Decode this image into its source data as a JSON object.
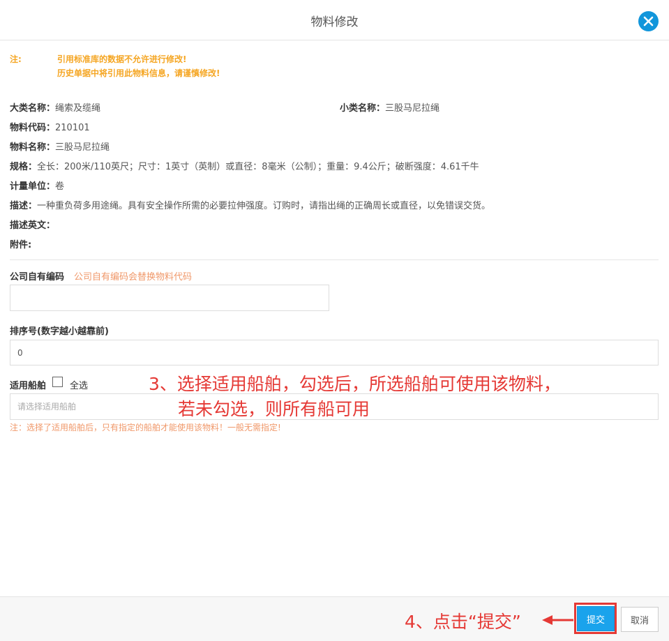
{
  "dialog": {
    "title": "物料修改"
  },
  "note": {
    "label": "注:",
    "lines": [
      "引用标准库的数据不允许进行修改!",
      "历史单据中将引用此物料信息，请谨慎修改!"
    ]
  },
  "info": {
    "category": {
      "label": "大类名称：",
      "value": "绳索及缆绳"
    },
    "subcategory": {
      "label": "小类名称：",
      "value": "三股马尼拉绳"
    },
    "code": {
      "label": "物料代码：",
      "value": "210101"
    },
    "name": {
      "label": "物料名称：",
      "value": "三股马尼拉绳"
    },
    "spec": {
      "label": "规格：",
      "value": "全长：200米/110英尺；尺寸：1英寸（英制）或直径：8毫米（公制）；重量：9.4公斤；破断强度：4.61千牛"
    },
    "unit": {
      "label": "计量单位：",
      "value": "卷"
    },
    "desc": {
      "label": "描述：",
      "value": "一种重负荷多用途绳。具有安全操作所需的必要拉伸强度。订购时，请指出绳的正确周长或直径，以免错误交货。"
    },
    "desc_en": {
      "label": "描述英文：",
      "value": ""
    },
    "attachment": {
      "label": "附件:",
      "value": ""
    }
  },
  "form": {
    "company_code": {
      "label": "公司自有编码",
      "hint": "公司自有编码会替换物料代码",
      "value": ""
    },
    "sort": {
      "label": "排序号(数字越小越靠前)",
      "value": "0"
    },
    "ships": {
      "label": "适用船舶",
      "select_all": "全选",
      "checked": false,
      "placeholder": "请选择适用船舶",
      "warning": "注：选择了适用船舶后，只有指定的船舶才能使用该物料！一般无需指定!"
    }
  },
  "annotations": {
    "step3_line1": "3、选择适用船舶，勾选后，所选船舶可使用该物料，",
    "step3_line2": "若未勾选，则所有船可用",
    "step4": "4、点击“提交”"
  },
  "footer": {
    "submit": "提交",
    "cancel": "取消"
  },
  "colors": {
    "accent": "#1aa3ec",
    "warning": "#f5a623",
    "annotation": "#e53935"
  },
  "icons": {
    "close": "close-icon",
    "arrow": "arrow-left-icon"
  }
}
